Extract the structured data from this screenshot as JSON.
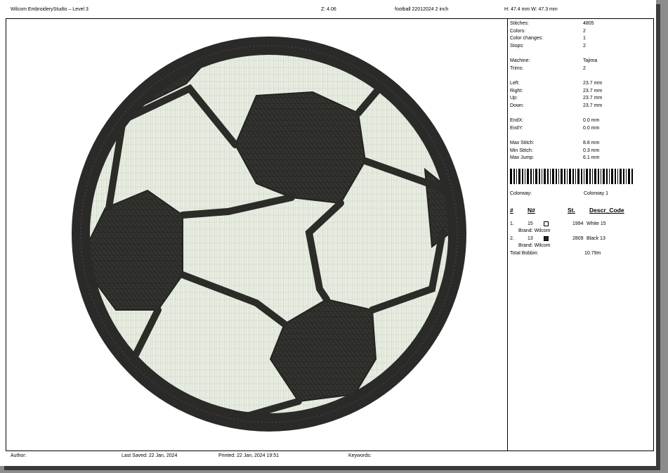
{
  "header": {
    "app_title": "Wilcom EmbroideryStudio – Level 3",
    "zoom": "Z: 4.06",
    "design_name": "football 22012024 2 inch",
    "dimensions": "H: 47.4 mm   W: 47.3 mm"
  },
  "stats": [
    {
      "label": "Stitches:",
      "value": "4805"
    },
    {
      "label": "Colors:",
      "value": "2"
    },
    {
      "label": "Color changes:",
      "value": "1"
    },
    {
      "label": "Stops:",
      "value": "2"
    },
    {
      "label": "Machine:",
      "value": "Tajima"
    },
    {
      "label": "Trims:",
      "value": "2"
    },
    {
      "label": "Left:",
      "value": "23.7 mm"
    },
    {
      "label": "Right:",
      "value": "23.7 mm"
    },
    {
      "label": "Up:",
      "value": "23.7 mm"
    },
    {
      "label": "Down:",
      "value": "23.7 mm"
    },
    {
      "label": "EndX:",
      "value": "0.0 mm"
    },
    {
      "label": "EndY:",
      "value": "0.0 mm"
    },
    {
      "label": "Max Stitch:",
      "value": "8.8 mm"
    },
    {
      "label": "Min Stitch:",
      "value": "0.3 mm"
    },
    {
      "label": "Max Jump:",
      "value": "6.1 mm"
    }
  ],
  "colorway": {
    "label": "Colorway:",
    "value": "Colorway 1"
  },
  "color_table": {
    "headers": {
      "num": "#",
      "n_num": "N#",
      "st": "St.",
      "descr": "Descr_Code"
    },
    "rows": [
      {
        "index": "1.",
        "n": "15",
        "swatch": "#ffffff",
        "stitches": "1994",
        "descr": "White 15",
        "brand": "Brand: Wilcom"
      },
      {
        "index": "2.",
        "n": "13",
        "swatch": "#222222",
        "stitches": "2809",
        "descr": "Black 13",
        "brand": "Brand: Wilcom"
      }
    ],
    "total_bobbin_label": "Total Bobbin:",
    "total_bobbin_value": "10.79m"
  },
  "footer": {
    "author": "Author:",
    "last_saved": "Last Saved: 22 Jan, 2024",
    "printed": "Printed: 22 Jan, 2024 19:51",
    "keywords": "Keywords:"
  },
  "colors": {
    "thread_dark": "#2a2a28",
    "thread_white": "#e8ede2"
  }
}
